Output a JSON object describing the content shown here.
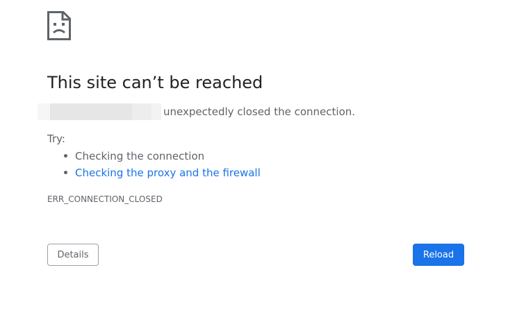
{
  "error": {
    "title": "This site can’t be reached",
    "message": "unexpectedly closed the connection.",
    "try_label": "Try:",
    "suggestions": [
      {
        "label": "Checking the connection",
        "is_link": false
      },
      {
        "label": "Checking the proxy and the firewall",
        "is_link": true
      }
    ],
    "code": "ERR_CONNECTION_CLOSED"
  },
  "buttons": {
    "details_label": "Details",
    "reload_label": "Reload"
  },
  "icons": {
    "error_page": "sad-page-icon"
  },
  "colors": {
    "title": "#202124",
    "text": "#5f6368",
    "link": "#1a73e8",
    "primary_button": "#1a73e8"
  }
}
